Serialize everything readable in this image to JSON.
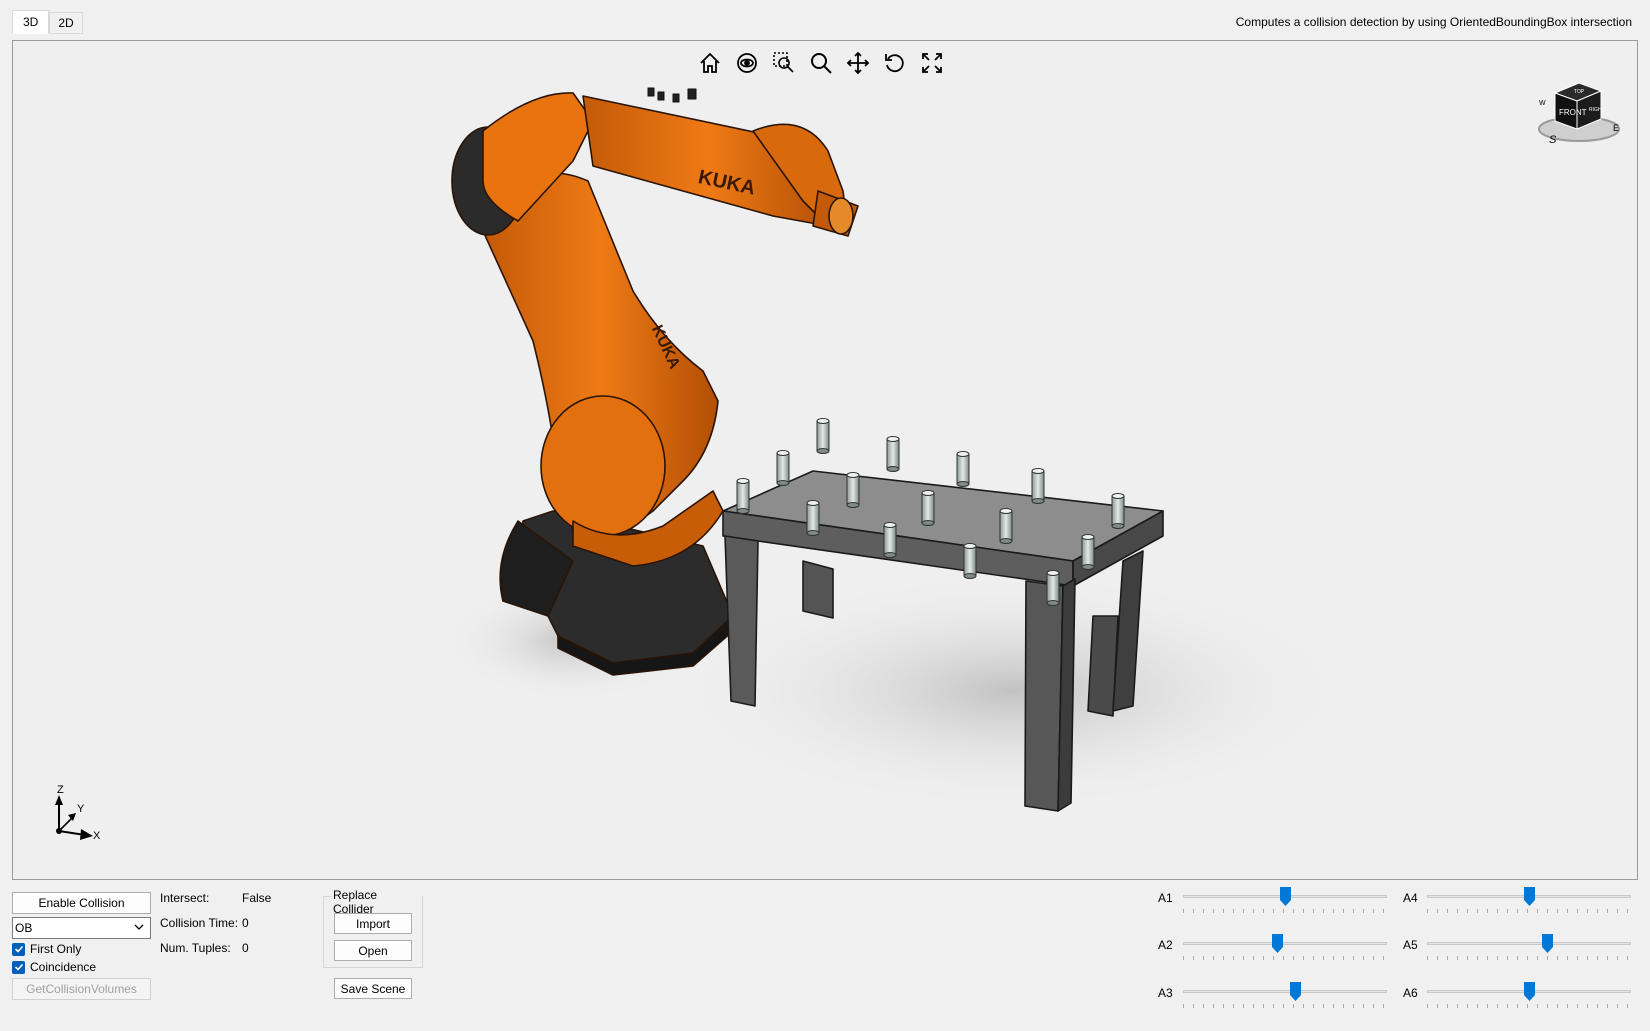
{
  "tabs": [
    {
      "label": "3D",
      "active": true
    },
    {
      "label": "2D",
      "active": false
    }
  ],
  "description": "Computes a collision detection by using OrientedBoundingBox intersection",
  "view_toolbar": [
    "home-icon",
    "orbit-icon",
    "zoom-window-icon",
    "zoom-icon",
    "pan-icon",
    "rotate-icon",
    "fit-screen-icon"
  ],
  "robot": {
    "brand_label": "KUKA",
    "color": "#e8700f"
  },
  "navcube": {
    "front": "FRONT",
    "top": "TOP",
    "right": "RIGHT",
    "compass_s": "S",
    "compass_w": "W",
    "compass_e": "E"
  },
  "triad": {
    "x": "X",
    "y": "Y",
    "z": "Z"
  },
  "controls": {
    "enable_button": "Enable Collision Detection",
    "method_select": "OB",
    "first_only": {
      "label": "First Only",
      "checked": true
    },
    "coincidence": {
      "label": "Coincidence",
      "checked": true
    },
    "get_volumes_button": "GetCollisionVolumes"
  },
  "stats": {
    "intersect_label": "Intersect:",
    "intersect_value": "False",
    "time_label": "Collision Time:",
    "time_value": "0",
    "tuples_label": "Num. Tuples:",
    "tuples_value": "0"
  },
  "replace_collider": {
    "title": "Replace Collider",
    "import": "Import",
    "open": "Open"
  },
  "save_scene": "Save Scene",
  "sliders": [
    {
      "label": "A1",
      "value": 0.5
    },
    {
      "label": "A2",
      "value": 0.46
    },
    {
      "label": "A3",
      "value": 0.55
    },
    {
      "label": "A4",
      "value": 0.5
    },
    {
      "label": "A5",
      "value": 0.59
    },
    {
      "label": "A6",
      "value": 0.5
    }
  ],
  "accent_color": "#0078d7"
}
